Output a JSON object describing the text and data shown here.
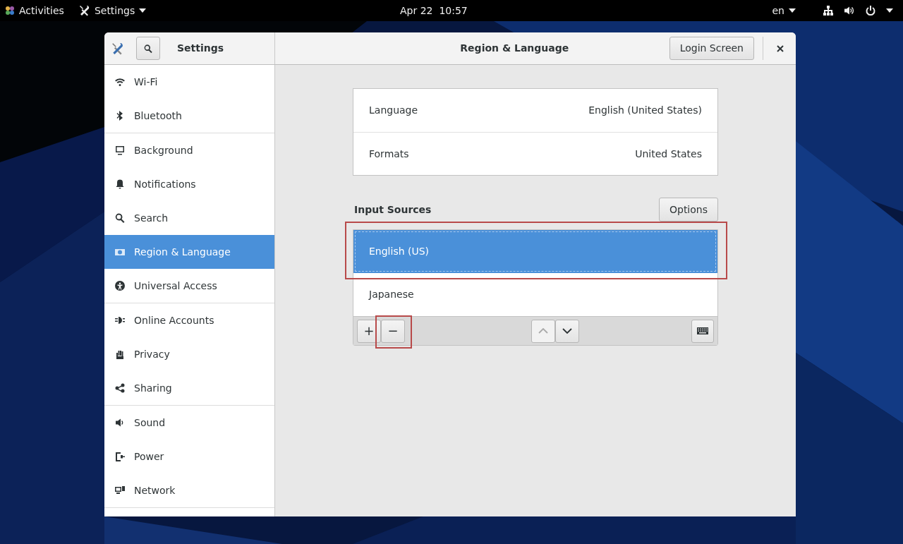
{
  "top_bar": {
    "activities": "Activities",
    "app_menu": "Settings",
    "clock": "Apr 22  10:57",
    "keyboard_layout": "en"
  },
  "window": {
    "sidebar_title": "Settings",
    "title": "Region & Language",
    "login_button": "Login Screen"
  },
  "sidebar": {
    "groups": [
      [
        {
          "label": "Wi-Fi",
          "selected": false
        },
        {
          "label": "Bluetooth",
          "selected": false
        }
      ],
      [
        {
          "label": "Background",
          "selected": false
        },
        {
          "label": "Notifications",
          "selected": false
        },
        {
          "label": "Search",
          "selected": false
        },
        {
          "label": "Region & Language",
          "selected": true
        },
        {
          "label": "Universal Access",
          "selected": false
        }
      ],
      [
        {
          "label": "Online Accounts",
          "selected": false
        },
        {
          "label": "Privacy",
          "selected": false
        },
        {
          "label": "Sharing",
          "selected": false
        }
      ],
      [
        {
          "label": "Sound",
          "selected": false
        },
        {
          "label": "Power",
          "selected": false
        },
        {
          "label": "Network",
          "selected": false
        }
      ]
    ]
  },
  "settings": [
    {
      "label": "Language",
      "value": "English (United States)"
    },
    {
      "label": "Formats",
      "value": "United States"
    }
  ],
  "input_sources": {
    "heading": "Input Sources",
    "options_button": "Options",
    "items": [
      {
        "label": "English (US)",
        "selected": true,
        "highlighted": true
      },
      {
        "label": "Japanese",
        "selected": false,
        "highlighted": false
      }
    ],
    "toolbar": [
      {
        "kind": "add",
        "label": "+",
        "highlighted": false,
        "disabled": false
      },
      {
        "kind": "remove",
        "label": "−",
        "highlighted": true,
        "disabled": false
      },
      {
        "kind": "up",
        "disabled": true,
        "highlighted": false
      },
      {
        "kind": "down",
        "disabled": false,
        "highlighted": false
      },
      {
        "kind": "keyboard",
        "disabled": false,
        "highlighted": false
      }
    ]
  }
}
